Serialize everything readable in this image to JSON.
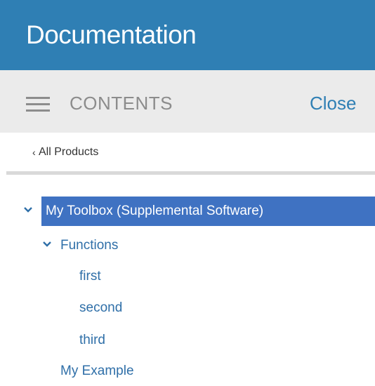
{
  "header": {
    "title": "Documentation"
  },
  "contents_bar": {
    "menu_icon": "hamburger-icon",
    "label": "CONTENTS",
    "close_label": "Close"
  },
  "back_link": {
    "icon": "chevron-left-icon",
    "label": "All Products"
  },
  "tree": {
    "root": {
      "label": "My Toolbox (Supplemental Software)",
      "expanded": true,
      "selected": true,
      "icon": "chevron-down-icon"
    },
    "functions": {
      "label": "Functions",
      "expanded": true,
      "icon": "chevron-down-icon",
      "items": [
        {
          "label": "first"
        },
        {
          "label": "second"
        },
        {
          "label": "third"
        }
      ]
    },
    "example": {
      "label": "My Example"
    }
  },
  "colors": {
    "header_bg": "#2f7fb4",
    "contents_bg": "#ebebeb",
    "selected_bg": "#3f72c2",
    "link": "#2f6fa8"
  }
}
